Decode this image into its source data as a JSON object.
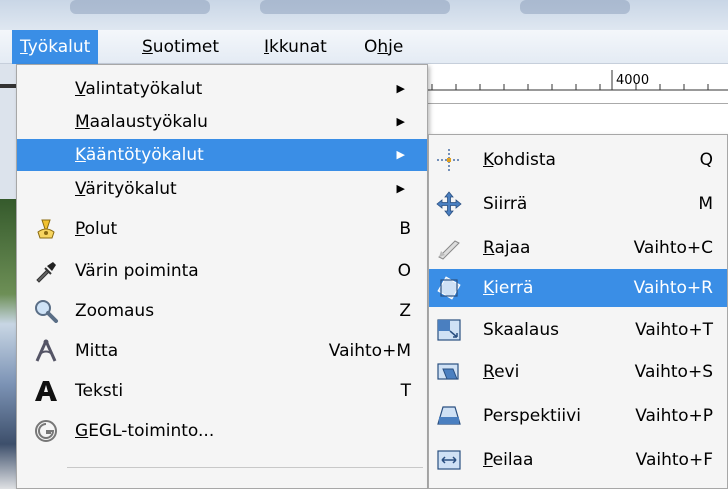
{
  "menubar": {
    "items": [
      {
        "pre": "",
        "mn": "T",
        "post": "yökalut"
      },
      {
        "pre": "",
        "mn": "S",
        "post": "uotimet"
      },
      {
        "pre": "",
        "mn": "I",
        "post": "kkunat"
      },
      {
        "pre": "O",
        "mn": "h",
        "post": "je"
      }
    ]
  },
  "ruler": {
    "label": "4000"
  },
  "tools_menu": {
    "items": [
      {
        "pre": "",
        "mn": "V",
        "post": "alintatyökalut",
        "accel": "",
        "icon": "none",
        "submenu": true
      },
      {
        "pre": "",
        "mn": "M",
        "post": "aalaustyökalu",
        "accel": "",
        "icon": "none",
        "submenu": true
      },
      {
        "pre": "",
        "mn": "K",
        "post": "ääntötyökalut",
        "accel": "",
        "icon": "none",
        "submenu": true
      },
      {
        "pre": "",
        "mn": "V",
        "post": "ärityökalut",
        "accel": "",
        "icon": "none",
        "submenu": true
      },
      {
        "pre": "",
        "mn": "P",
        "post": "olut",
        "accel": "B",
        "icon": "paths-tool-icon"
      },
      {
        "pre": "Värin poiminta",
        "mn": "",
        "post": "",
        "accel": "O",
        "icon": "color-picker-icon"
      },
      {
        "pre": "Zoomaus",
        "mn": "",
        "post": "",
        "accel": "Z",
        "icon": "zoom-icon"
      },
      {
        "pre": "Mitta",
        "mn": "",
        "post": "",
        "accel": "Vaihto+M",
        "icon": "measure-icon"
      },
      {
        "pre": "Teksti",
        "mn": "",
        "post": "",
        "accel": "T",
        "icon": "text-tool-icon"
      },
      {
        "pre": "",
        "mn": "G",
        "post": "EGL-toiminto...",
        "accel": "",
        "icon": "gegl-icon"
      }
    ]
  },
  "transform_menu": {
    "items": [
      {
        "pre": "",
        "mn": "K",
        "post": "ohdista",
        "accel": "Q",
        "icon": "align-tool-icon"
      },
      {
        "pre": "Siirrä",
        "mn": "",
        "post": "",
        "accel": "M",
        "icon": "move-tool-icon"
      },
      {
        "pre": "",
        "mn": "R",
        "post": "ajaa",
        "accel": "Vaihto+C",
        "icon": "crop-tool-icon"
      },
      {
        "pre": "",
        "mn": "K",
        "post": "ierrä",
        "accel": "Vaihto+R",
        "icon": "rotate-tool-icon"
      },
      {
        "pre": "Skaalaus",
        "mn": "",
        "post": "",
        "accel": "Vaihto+T",
        "icon": "scale-tool-icon"
      },
      {
        "pre": "",
        "mn": "R",
        "post": "evi",
        "accel": "Vaihto+S",
        "icon": "shear-tool-icon"
      },
      {
        "pre": "Perspektiivi",
        "mn": "",
        "post": "",
        "accel": "Vaihto+P",
        "icon": "perspective-tool-icon"
      },
      {
        "pre": "",
        "mn": "P",
        "post": "eilaa",
        "accel": "Vaihto+F",
        "icon": "flip-tool-icon"
      }
    ]
  },
  "colors": {
    "highlight": "#3a8ee6",
    "menu_bg": "#f5f5f5"
  }
}
